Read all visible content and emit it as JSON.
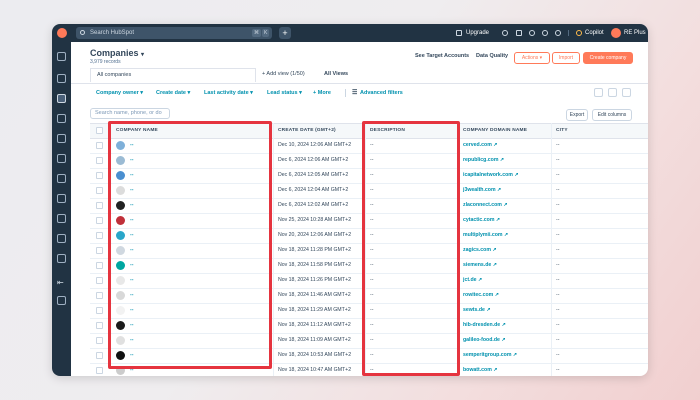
{
  "topbar": {
    "search_placeholder": "Search HubSpot",
    "shortcut_1": "⌘",
    "shortcut_2": "K",
    "add_label": "+",
    "upgrade_label": "Upgrade",
    "copilot_label": "Copilot",
    "account_label": "RE Plus"
  },
  "header": {
    "title": "Companies",
    "records_count": "3,979 records",
    "target_accounts_link": "See Target Accounts",
    "data_quality_link": "Data Quality",
    "actions_label": "Actions ▾",
    "import_label": "Import",
    "create_label": "Create company"
  },
  "views": {
    "current": "All companies",
    "add_view": "+ Add view (1/50)",
    "all_views": "All Views"
  },
  "filters": {
    "items": [
      "Company owner ▾",
      "Create date ▾",
      "Last activity date ▾",
      "Lead status ▾",
      "+ More"
    ],
    "advanced": "Advanced filters"
  },
  "table_tools": {
    "search_placeholder": "Search name, phone, or do",
    "export_label": "Export",
    "edit_columns_label": "Edit columns"
  },
  "table": {
    "columns": [
      "COMPANY NAME",
      "CREATE DATE (GMT+2)",
      "DESCRIPTION",
      "COMPANY DOMAIN NAME",
      "CITY"
    ],
    "rows": [
      {
        "name": "--",
        "date": "Dec 10, 2024 12:06 AM GMT+2",
        "description": "--",
        "domain": "cerved.com",
        "city": "--",
        "logo_color": "#7fb0d9"
      },
      {
        "name": "--",
        "date": "Dec 6, 2024 12:06 AM GMT+2",
        "description": "--",
        "domain": "republicg.com",
        "city": "--",
        "logo_color": "#9bbbd4"
      },
      {
        "name": "--",
        "date": "Dec 6, 2024 12:05 AM GMT+2",
        "description": "--",
        "domain": "icapitalnetwork.com",
        "city": "--",
        "logo_color": "#4a8fd0"
      },
      {
        "name": "--",
        "date": "Dec 6, 2024 12:04 AM GMT+2",
        "description": "--",
        "domain": "j3wealth.com",
        "city": "--",
        "logo_color": "#dcdcdc"
      },
      {
        "name": "--",
        "date": "Dec 6, 2024 12:02 AM GMT+2",
        "description": "--",
        "domain": "zlaconnect.com",
        "city": "--",
        "logo_color": "#222222"
      },
      {
        "name": "--",
        "date": "Nov 25, 2024 10:28 AM GMT+2",
        "description": "--",
        "domain": "cytactic.com",
        "city": "--",
        "logo_color": "#c0303a"
      },
      {
        "name": "--",
        "date": "Nov 20, 2024 12:06 AM GMT+2",
        "description": "--",
        "domain": "multiplymii.com",
        "city": "--",
        "logo_color": "#2aa6c9"
      },
      {
        "name": "--",
        "date": "Nov 18, 2024 11:28 PM GMT+2",
        "description": "--",
        "domain": "zagics.com",
        "city": "--",
        "logo_color": "#d0d8e0"
      },
      {
        "name": "--",
        "date": "Nov 18, 2024 11:58 PM GMT+2",
        "description": "--",
        "domain": "siemens.de",
        "city": "--",
        "logo_color": "#00a6a0"
      },
      {
        "name": "--",
        "date": "Nov 18, 2024 11:26 PM GMT+2",
        "description": "--",
        "domain": "jct.de",
        "city": "--",
        "logo_color": "#e8e8e8"
      },
      {
        "name": "--",
        "date": "Nov 18, 2024 11:46 AM GMT+2",
        "description": "--",
        "domain": "rowitec.com",
        "city": "--",
        "logo_color": "#d8d8d8"
      },
      {
        "name": "--",
        "date": "Nov 18, 2024 11:29 AM GMT+2",
        "description": "--",
        "domain": "sewts.de",
        "city": "--",
        "logo_color": "#f2f2f2"
      },
      {
        "name": "--",
        "date": "Nov 18, 2024 11:12 AM GMT+2",
        "description": "--",
        "domain": "hib-dresden.de",
        "city": "--",
        "logo_color": "#1b1b1b"
      },
      {
        "name": "--",
        "date": "Nov 18, 2024 11:09 AM GMT+2",
        "description": "--",
        "domain": "galileo-food.de",
        "city": "--",
        "logo_color": "#e0e0e0"
      },
      {
        "name": "--",
        "date": "Nov 18, 2024 10:53 AM GMT+2",
        "description": "--",
        "domain": "semperitgroup.com",
        "city": "--",
        "logo_color": "#111111"
      },
      {
        "name": "--",
        "date": "Nov 18, 2024 10:47 AM GMT+2",
        "description": "--",
        "domain": "bowatt.com",
        "city": "--",
        "logo_color": "#cccccc"
      }
    ]
  },
  "colors": {
    "nav_bg": "#213343",
    "accent": "#ff7a59",
    "link": "#0091ae",
    "highlight": "#e5343f"
  }
}
